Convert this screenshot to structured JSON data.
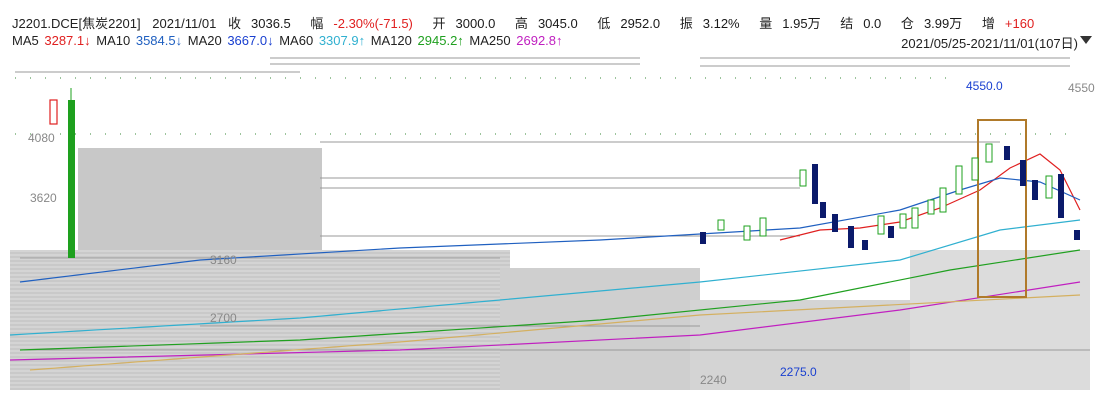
{
  "header": {
    "symbol": "J2201.DCE[焦炭2201]",
    "date": "2021/11/01",
    "close_label": "收",
    "close_value": "3036.5",
    "change_label": "幅",
    "change_value": "-2.30%(-71.5)",
    "open_label": "开",
    "open_value": "3000.0",
    "high_label": "高",
    "high_value": "3045.0",
    "low_label": "低",
    "low_value": "2952.0",
    "amplitude_label": "振",
    "amplitude_value": "3.12%",
    "volume_label": "量",
    "volume_value": "1.95万",
    "settle_label": "结",
    "settle_value": "0.0",
    "oi_label": "仓",
    "oi_value": "3.99万",
    "oi_change_label": "增",
    "oi_change_value": "+160"
  },
  "ma_bar": {
    "items": [
      {
        "name": "MA5",
        "value": "3287.1↓",
        "color": "#e02020"
      },
      {
        "name": "MA10",
        "value": "3584.5↓",
        "color": "#2060c0"
      },
      {
        "name": "MA20",
        "value": "3667.0↓",
        "color": "#1a40d0"
      },
      {
        "name": "MA60",
        "value": "3307.9↑",
        "color": "#30b0d0"
      },
      {
        "name": "MA120",
        "value": "2945.2↑",
        "color": "#20a020"
      },
      {
        "name": "MA250",
        "value": "2692.8↑",
        "color": "#c020c0"
      }
    ],
    "range": "2021/05/25-2021/11/01(107日)"
  },
  "chart_data": {
    "type": "candlestick",
    "title": "",
    "price_labels": [
      "4080",
      "3620",
      "3160",
      "2700",
      "2240",
      "2275.0",
      "4550.0",
      "4550"
    ],
    "y_ticks": [
      4080,
      3620,
      3160,
      2700,
      2240
    ],
    "annotations": [
      {
        "text": "4550.0",
        "kind": "high-marker"
      },
      {
        "text": "2275.0",
        "kind": "low-marker"
      }
    ],
    "colors": {
      "up": "#e02020",
      "down": "#0b1a6b",
      "highlight_box": "#b07a2a",
      "ma5": "#e02020",
      "ma10": "#2060c0",
      "ma20": "#1a40d0",
      "ma60": "#30b0d0",
      "ma120": "#20a020",
      "ma250": "#c020c0"
    }
  }
}
